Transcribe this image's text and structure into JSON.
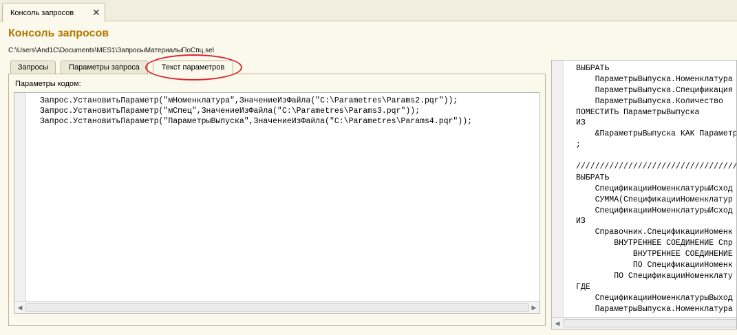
{
  "window_tab": {
    "label": "Консоль запросов",
    "close": "✕"
  },
  "page": {
    "title": "Консоль запросов",
    "file_path": "C:\\Users\\And1C\\Documents\\MES1\\ЗапросыМатериалыПоСпц.sel"
  },
  "tabs": [
    {
      "label": "Запросы"
    },
    {
      "label": "Параметры запроса"
    },
    {
      "label": "Текст параметров"
    }
  ],
  "params_panel": {
    "label": "Параметры кодом:",
    "code_lines": [
      "Запрос.УстановитьПараметр(\"мНоменклатура\",ЗначениеИзФайла(\"C:\\Parametres\\Params2.pqr\"));",
      "Запрос.УстановитьПараметр(\"мСпец\",ЗначениеИзФайла(\"C:\\Parametres\\Params3.pqr\"));",
      "Запрос.УстановитьПараметр(\"ПараметрыВыпуска\",ЗначениеИзФайла(\"C:\\Parametres\\Params4.pqr\"));"
    ]
  },
  "query_pane": {
    "lines": [
      "ВЫБРАТЬ",
      "    ПараметрыВыпуска.Номенклатура",
      "    ПараметрыВыпуска.Спецификация",
      "    ПараметрыВыпуска.Количество",
      "ПОМЕСТИТЬ ПараметрыВыпуска",
      "ИЗ",
      "    &ПараметрыВыпуска КАК Параметр",
      ";",
      "",
      "//////////////////////////////////",
      "ВЫБРАТЬ",
      "    СпецификацииНоменклатурыИсход",
      "    СУММА(СпецификацииНоменклатур",
      "    СпецификацииНоменклатурыИсход",
      "ИЗ",
      "    Справочник.СпецификацииНоменк",
      "        ВНУТРЕННЕЕ СОЕДИНЕНИЕ Спр",
      "            ВНУТРЕННЕЕ СОЕДИНЕНИЕ",
      "            ПО СпецификацииНоменк",
      "        ПО СпецификацииНоменклату",
      "ГДЕ",
      "    СпецификацииНоменклатурыВыход",
      "    ПараметрыВыпуска.Номенклатура"
    ]
  },
  "colors": {
    "title": "#b27800",
    "highlight_ring": "#d9232e",
    "background": "#fbf8ec"
  }
}
